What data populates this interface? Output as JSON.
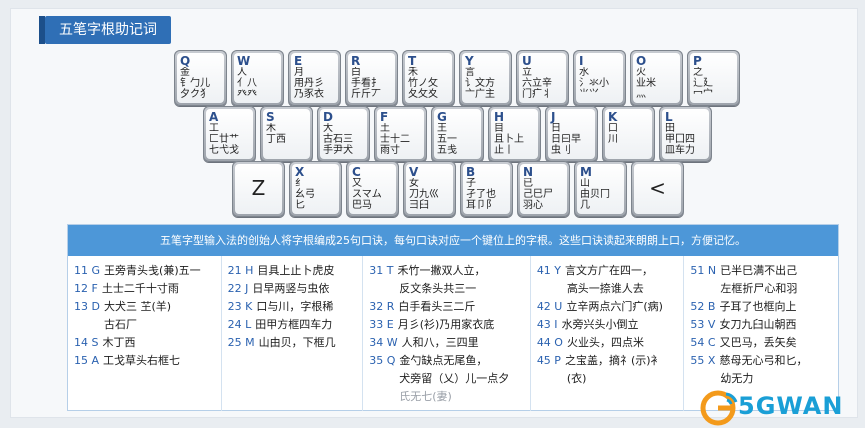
{
  "title": "五笔字根助记词",
  "colors": {
    "accent": "#2f6fb6",
    "header_blue": "#4d97d8"
  },
  "keyboard": {
    "row1": [
      {
        "letter": "Q",
        "code": "35",
        "roots": "金\n钅勹儿\n夕ク犭"
      },
      {
        "letter": "W",
        "code": "34",
        "roots": "人\n亻八\n癶癶"
      },
      {
        "letter": "E",
        "code": "33",
        "roots": "月\n用丹彡\n乃豕衣"
      },
      {
        "letter": "R",
        "code": "32",
        "roots": "白\n手看扌\n斤斤丆"
      },
      {
        "letter": "T",
        "code": "31",
        "roots": "禾\n竹ノ攵\n夂攵夊"
      },
      {
        "letter": "Y",
        "code": "41",
        "roots": "言\n讠文方\n亠广主"
      },
      {
        "letter": "U",
        "code": "42",
        "roots": "立\n六立辛\n门疒丬"
      },
      {
        "letter": "I",
        "code": "43",
        "roots": "水\n氵氺小\n⺌⺍"
      },
      {
        "letter": "O",
        "code": "44",
        "roots": "火\n业米\n灬"
      },
      {
        "letter": "P",
        "code": "45",
        "roots": "之\n辶廴\n冖宀"
      }
    ],
    "row2": [
      {
        "letter": "A",
        "code": "15",
        "roots": "工\n匚廿艹\n七弋戈"
      },
      {
        "letter": "S",
        "code": "14",
        "roots": "木\n丁西"
      },
      {
        "letter": "D",
        "code": "13",
        "roots": "大\n古石三\n手尹犬"
      },
      {
        "letter": "F",
        "code": "12",
        "roots": "土\n士十二\n雨寸"
      },
      {
        "letter": "G",
        "code": "11",
        "roots": "王\n五一\n五戋"
      },
      {
        "letter": "H",
        "code": "21",
        "roots": "目\n且卜上\n止丨"
      },
      {
        "letter": "J",
        "code": "22",
        "roots": "日\n日曰早\n虫刂"
      },
      {
        "letter": "K",
        "code": "23",
        "roots": "口\n川"
      },
      {
        "letter": "L",
        "code": "24",
        "roots": "田\n甲囗四\n皿车力"
      }
    ],
    "row3": [
      {
        "letter": "Z",
        "code": "",
        "roots": ""
      },
      {
        "letter": "X",
        "code": "55",
        "roots": "纟\n幺弓\n匕"
      },
      {
        "letter": "C",
        "code": "54",
        "roots": "又\nスマム\n巴马"
      },
      {
        "letter": "V",
        "code": "53",
        "roots": "女\n刀九巛\n彐臼"
      },
      {
        "letter": "B",
        "code": "52",
        "roots": "子\n孑了也\n耳卩阝"
      },
      {
        "letter": "N",
        "code": "51",
        "roots": "已\n己巳尸\n羽心"
      },
      {
        "letter": "M",
        "code": "25",
        "roots": "山\n由贝冂\n几"
      },
      {
        "letter": "<",
        "code": "",
        "roots": ""
      }
    ]
  },
  "info": {
    "heading": "五笔字型输入法的创始人将字根编成25句口诀，每句口诀对应一个键位上的字根。这些口诀读起来朗朗上口，方便记忆。",
    "columns": [
      [
        {
          "num": "11 G",
          "text": "王旁青头戋(兼)五一"
        },
        {
          "num": "12 F",
          "text": "土士二千十寸雨"
        },
        {
          "num": "13 D",
          "text": "大犬三 芏(羊)"
        },
        {
          "num": "",
          "text": "古石厂"
        },
        {
          "num": "14 S",
          "text": "木丁西"
        },
        {
          "num": "15 A",
          "text": "工戈草头右框七"
        }
      ],
      [
        {
          "num": "21 H",
          "text": "目具上止卜虎皮"
        },
        {
          "num": "22 J",
          "text": "日早两竖与虫依"
        },
        {
          "num": "23 K",
          "text": "口与川，字根稀"
        },
        {
          "num": "24 L",
          "text": "田甲方框四车力"
        },
        {
          "num": "25 M",
          "text": "山由贝，下框几"
        }
      ],
      [
        {
          "num": "31 T",
          "text": "禾竹一撇双人立，"
        },
        {
          "num": "",
          "text": "反文条头共三一"
        },
        {
          "num": "32 R",
          "text": "白手看头三二斤"
        },
        {
          "num": "33 E",
          "text": "月彡(衫)乃用家衣底"
        },
        {
          "num": "34 W",
          "text": "人和八，三四里"
        },
        {
          "num": "35 Q",
          "text": "金勺缺点无尾鱼，"
        },
        {
          "num": "",
          "text": "犬旁留（乂）儿一点夕"
        },
        {
          "num": "",
          "text": "氏无七(妻)"
        }
      ],
      [
        {
          "num": "41 Y",
          "text": "言文方广在四一，"
        },
        {
          "num": "",
          "text": "高头一捺谁人去"
        },
        {
          "num": "42 U",
          "text": "立辛两点六门疒(病)"
        },
        {
          "num": "43 I",
          "text": "水旁兴头小倒立"
        },
        {
          "num": "44 O",
          "text": "火业头，四点米"
        },
        {
          "num": "45 P",
          "text": "之宝盖，摘礻(示)衤"
        },
        {
          "num": "",
          "text": "(衣)"
        }
      ],
      [
        {
          "num": "51 N",
          "text": "已半巳满不出己"
        },
        {
          "num": "",
          "text": "左框折尸心和羽"
        },
        {
          "num": "52 B",
          "text": "子耳了也框向上"
        },
        {
          "num": "53 V",
          "text": "女刀九臼山朝西"
        },
        {
          "num": "54 C",
          "text": "又巴马，丢矢矣"
        },
        {
          "num": "55 X",
          "text": "慈母无心弓和匕，"
        },
        {
          "num": "",
          "text": "幼无力"
        }
      ]
    ]
  },
  "watermark": {
    "text": "5GWAN"
  }
}
